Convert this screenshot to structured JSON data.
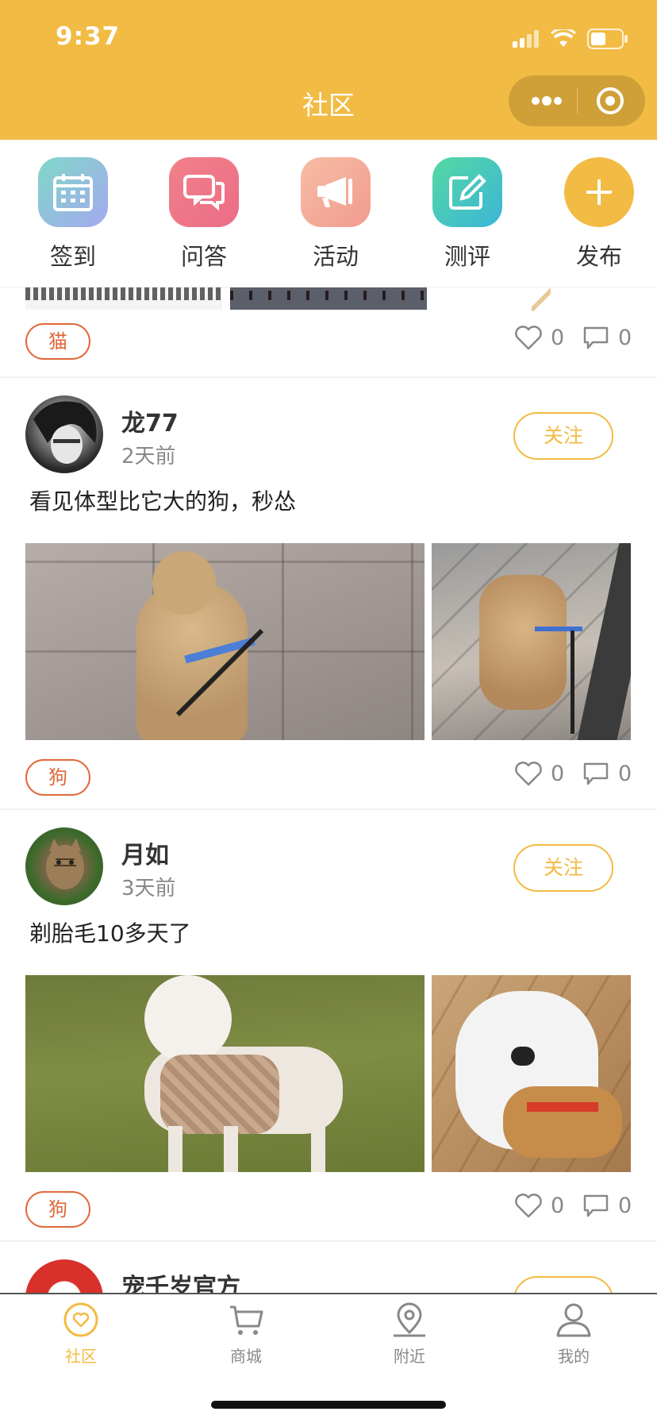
{
  "status_bar": {
    "time": "9:37"
  },
  "nav": {
    "title": "社区"
  },
  "quick_menu": [
    {
      "label": "签到",
      "icon": "calendar-icon"
    },
    {
      "label": "问答",
      "icon": "chat-bubbles-icon"
    },
    {
      "label": "活动",
      "icon": "megaphone-icon"
    },
    {
      "label": "测评",
      "icon": "edit-icon"
    },
    {
      "label": "发布",
      "icon": "plus-icon"
    }
  ],
  "colors": {
    "accent": "#F2BB44",
    "tag": "#E0683A",
    "text": "#333333",
    "muted": "#888888"
  },
  "posts": [
    {
      "tag": "猫",
      "likes": "0",
      "comments": "0"
    },
    {
      "username": "龙77",
      "time": "2天前",
      "follow_label": "关注",
      "text": "看见体型比它大的狗，秒怂",
      "tag": "狗",
      "likes": "0",
      "comments": "0"
    },
    {
      "username": "月如",
      "time": "3天前",
      "follow_label": "关注",
      "text": "剃胎毛10多天了",
      "tag": "狗",
      "likes": "0",
      "comments": "0"
    },
    {
      "username": "宠千岁官方"
    }
  ],
  "tabbar": [
    {
      "label": "社区",
      "icon": "community-icon",
      "active": true
    },
    {
      "label": "商城",
      "icon": "cart-icon",
      "active": false
    },
    {
      "label": "附近",
      "icon": "location-icon",
      "active": false
    },
    {
      "label": "我的",
      "icon": "user-icon",
      "active": false
    }
  ]
}
